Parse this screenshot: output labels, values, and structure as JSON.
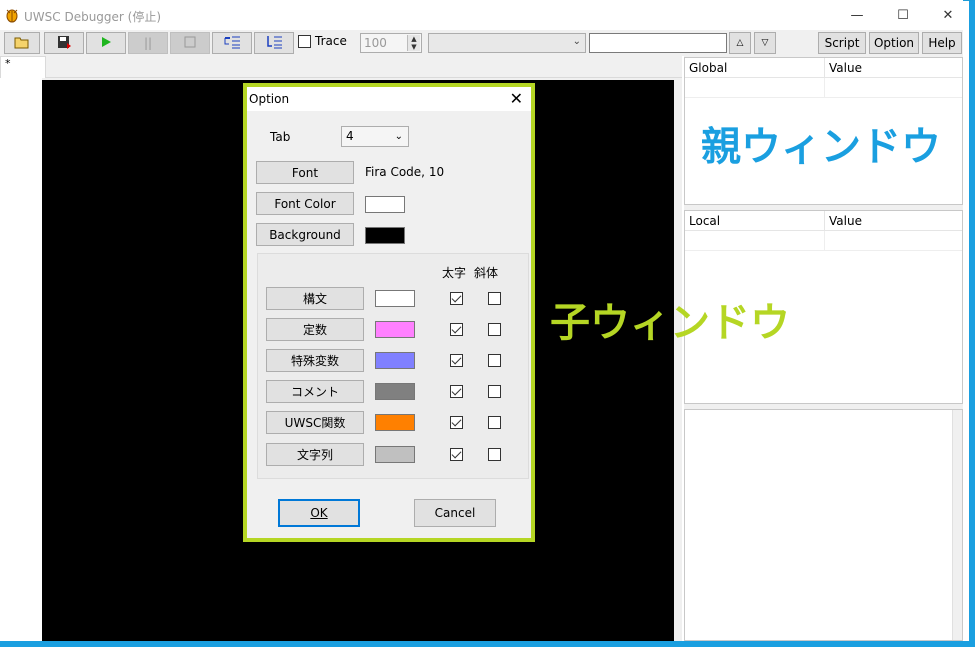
{
  "window": {
    "title": "UWSC Debugger (停止)"
  },
  "title_buttons": [
    "—",
    "☐",
    "✕"
  ],
  "toolbar": {
    "trace_label": "Trace",
    "trace_value": "100",
    "script_label": "Script",
    "option_label": "Option",
    "help_label": "Help",
    "find_up": "△",
    "find_down": "▽"
  },
  "editor": {
    "tab_label": "*"
  },
  "global_pane": {
    "col1": "Global",
    "col2": "Value",
    "overlay_text": "親ウィンドウ",
    "overlay_color": "#1a9fe0"
  },
  "local_pane": {
    "col1": "Local",
    "col2": "Value"
  },
  "child_label": {
    "text": "子ウィンドウ",
    "color": "#b5d624"
  },
  "dialog": {
    "title": "Option",
    "tab_label": "Tab",
    "tab_value": "4",
    "font_button": "Font",
    "font_value": "Fira Code, 10",
    "font_color_button": "Font Color",
    "background_button": "Background",
    "bold_header": "太字",
    "italic_header": "斜体",
    "syntax_rows": [
      {
        "label": "構文",
        "color": "#ffffff",
        "bold": true,
        "italic": false
      },
      {
        "label": "定数",
        "color": "#ff80ff",
        "bold": true,
        "italic": false
      },
      {
        "label": "特殊変数",
        "color": "#8080ff",
        "bold": true,
        "italic": false
      },
      {
        "label": "コメント",
        "color": "#808080",
        "bold": true,
        "italic": false
      },
      {
        "label": "UWSC関数",
        "color": "#ff8000",
        "bold": true,
        "italic": false
      },
      {
        "label": "文字列",
        "color": "#c0c0c0",
        "bold": true,
        "italic": false
      }
    ],
    "ok_button": "OK",
    "cancel_button": "Cancel"
  }
}
